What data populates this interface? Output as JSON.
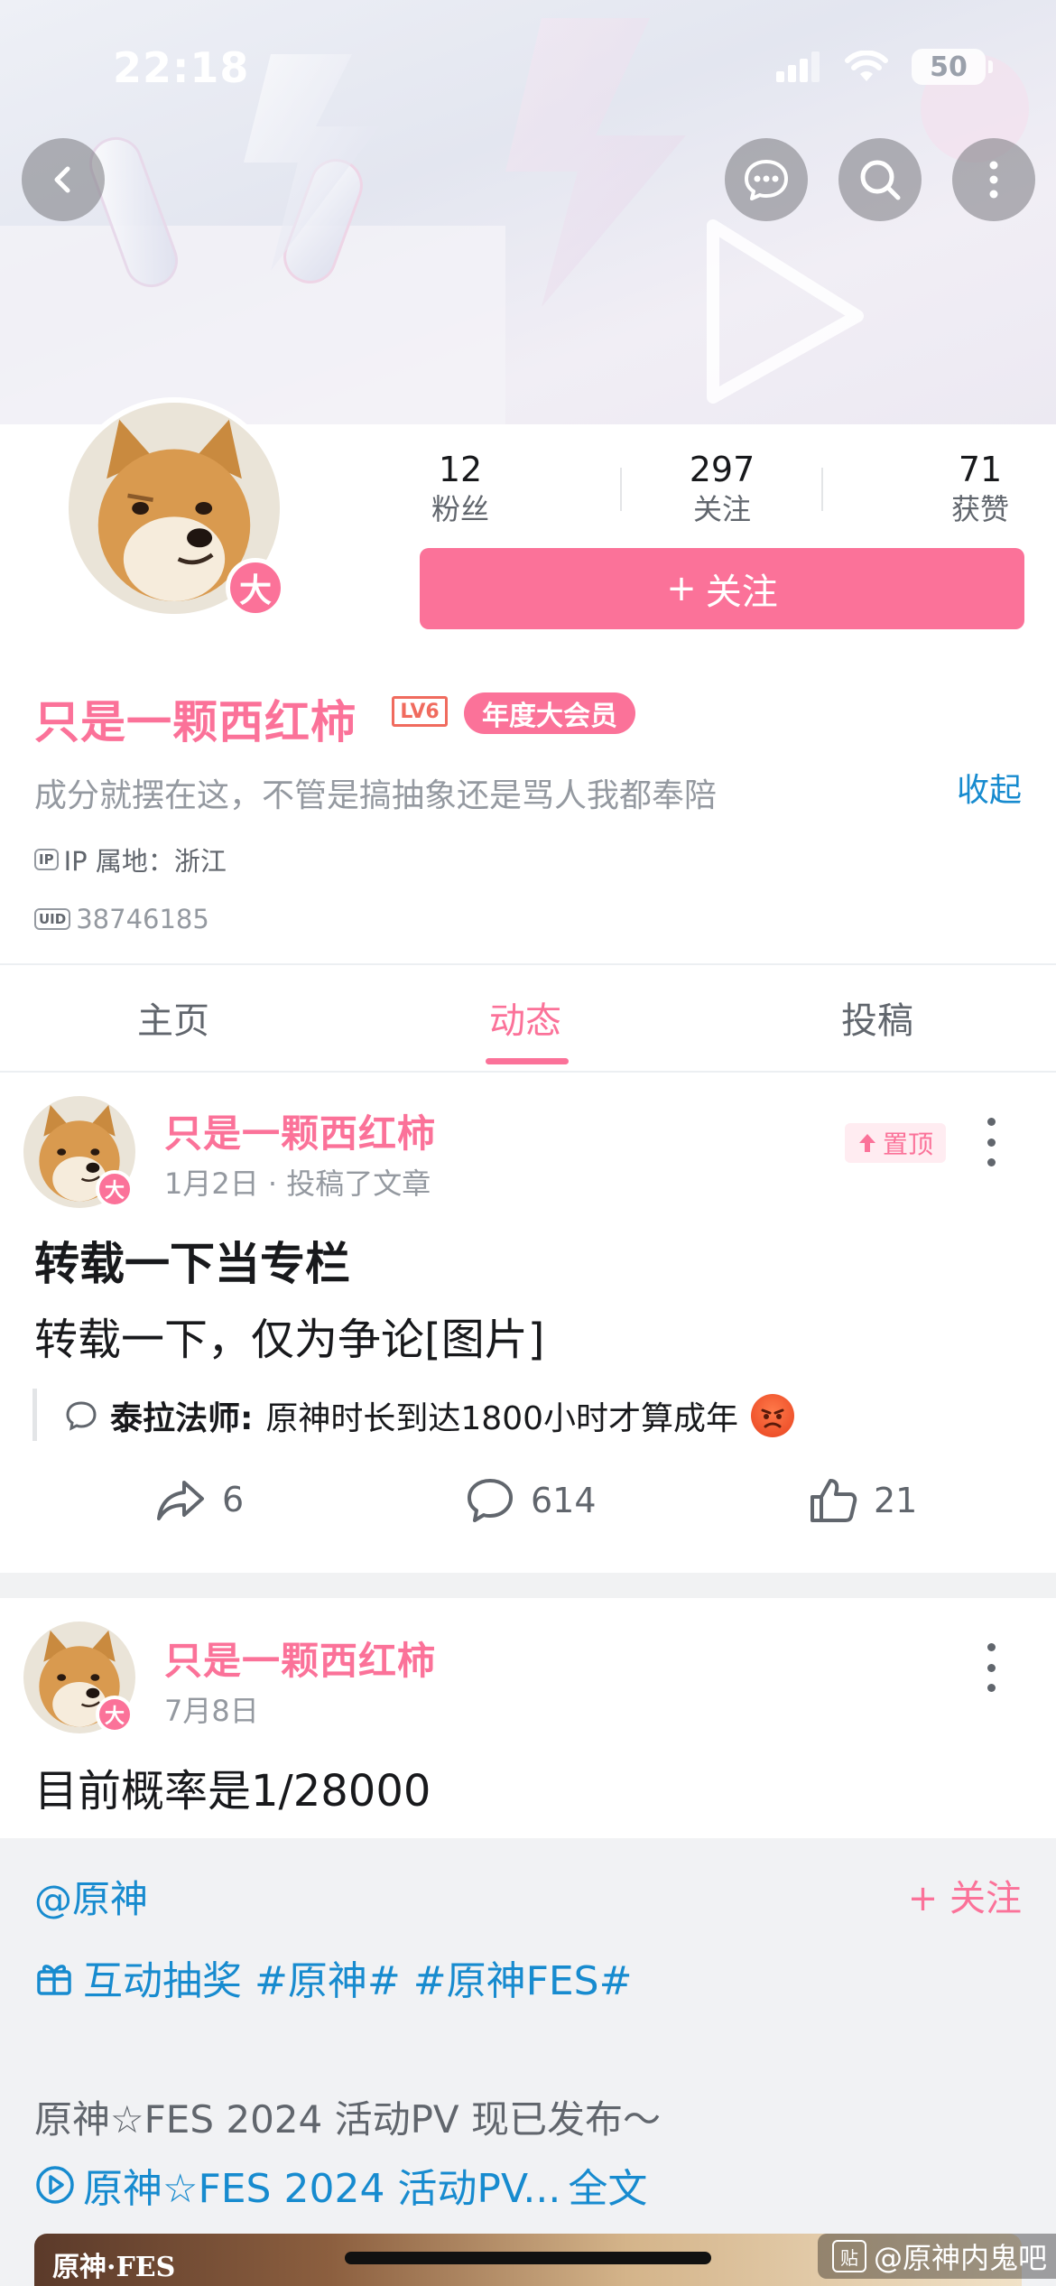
{
  "status_bar": {
    "time": "22:18",
    "battery": "50"
  },
  "profile": {
    "avatar_badge": "大",
    "stats": [
      {
        "value": "12",
        "label": "粉丝"
      },
      {
        "value": "297",
        "label": "关注"
      },
      {
        "value": "71",
        "label": "获赞"
      }
    ],
    "follow_label": "关注",
    "follow_plus": "+",
    "username": "只是一颗西红柿",
    "level_badge": "LV6",
    "vip_badge": "年度大会员",
    "signature": "成分就摆在这，不管是搞抽象还是骂人我都奉陪",
    "collapse_label": "收起",
    "ip_tag": "IP",
    "ip_label": "IP 属地：浙江",
    "uid_tag": "UID",
    "uid": "38746185"
  },
  "tabs": [
    {
      "label": "主页",
      "active": false
    },
    {
      "label": "动态",
      "active": true
    },
    {
      "label": "投稿",
      "active": false
    }
  ],
  "posts": [
    {
      "author": "只是一颗西红柿",
      "avatar_badge": "大",
      "subtitle": "1月2日 · 投稿了文章",
      "pin_label": "置顶",
      "title": "转载一下当专栏",
      "text": "转载一下，仅为争论[图片]",
      "quote_author": "泰拉法师:",
      "quote_text": "原神时长到达1800小时才算成年",
      "actions": {
        "share": "6",
        "comment": "614",
        "like": "21"
      }
    },
    {
      "author": "只是一颗西红柿",
      "avatar_badge": "大",
      "subtitle": "7月8日",
      "text": "目前概率是1/28000",
      "repost": {
        "at": "@原神",
        "follow": "+ 关注",
        "tags": "互动抽奖 #原神# #原神FES#",
        "body": "原神☆FES 2024 活动PV 现已发布～",
        "link": "原神☆FES 2024 活动PV...",
        "full_text": "全文",
        "thumb_logo": "原神·FES"
      }
    }
  ],
  "watermark": {
    "icon": "贴",
    "text": "@原神内鬼吧"
  },
  "colors": {
    "accent": "#fb7299",
    "link": "#178bcf",
    "muted": "#9499a0"
  },
  "icons": [
    "back-icon",
    "message-icon",
    "search-icon",
    "more-icon",
    "share-icon",
    "comment-icon",
    "like-icon",
    "gift-icon",
    "play-icon"
  ]
}
